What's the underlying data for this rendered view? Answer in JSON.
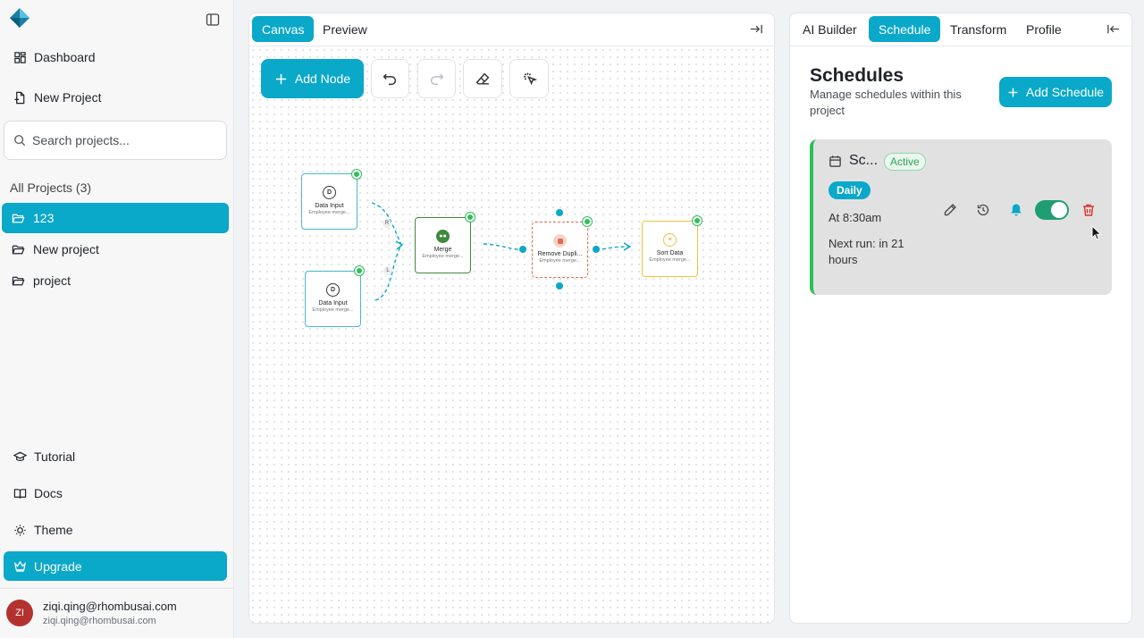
{
  "sidebar": {
    "nav": {
      "dashboard": "Dashboard",
      "new_project": "New Project"
    },
    "search": {
      "placeholder": "Search projects..."
    },
    "projects_label": "All Projects (3)",
    "projects": [
      {
        "name": "123",
        "active": true
      },
      {
        "name": "New project",
        "active": false
      },
      {
        "name": "project",
        "active": false
      }
    ],
    "bottom": {
      "tutorial": "Tutorial",
      "docs": "Docs",
      "theme": "Theme",
      "upgrade": "Upgrade"
    },
    "user": {
      "initials": "ZI",
      "name": "ziqi.qing@rhombusai.com",
      "email": "ziqi.qing@rhombusai.com"
    }
  },
  "canvas": {
    "tabs": [
      "Canvas",
      "Preview"
    ],
    "active_tab": "Canvas",
    "add_node_label": "Add Node",
    "nodes": [
      {
        "id": "input1",
        "icon_letter": "D",
        "title": "Data Input",
        "subtitle": "Employee merge...",
        "color": "#4ab7d0"
      },
      {
        "id": "input2",
        "icon_letter": "D",
        "title": "Data Input",
        "subtitle": "Employee merge...",
        "color": "#4ab7d0"
      },
      {
        "id": "merge",
        "title": "Merge",
        "subtitle": "Employee merge...",
        "color": "#3f8a3c"
      },
      {
        "id": "dedupe",
        "title": "Remove Dupli...",
        "subtitle": "Employee merge...",
        "color": "#e0704a"
      },
      {
        "id": "sort",
        "title": "Sort Data",
        "subtitle": "Employee merge...",
        "color": "#f0c33c"
      }
    ],
    "edge_labels": [
      "R",
      "L"
    ]
  },
  "schedule_panel": {
    "tabs": [
      "AI Builder",
      "Schedule",
      "Transform",
      "Profile"
    ],
    "active_tab": "Schedule",
    "title": "Schedules",
    "subtitle": "Manage schedules within this project",
    "add_label": "Add Schedule",
    "card": {
      "name": "Sc...",
      "status": "Active",
      "frequency": "Daily",
      "time": "At 8:30am",
      "next_run": "Next run: in 21 hours",
      "enabled": true
    }
  },
  "colors": {
    "accent": "#0aa8c9",
    "active_green": "#2ebf5a",
    "toggle_on": "#1f9e74",
    "delete_red": "#d9342b"
  }
}
